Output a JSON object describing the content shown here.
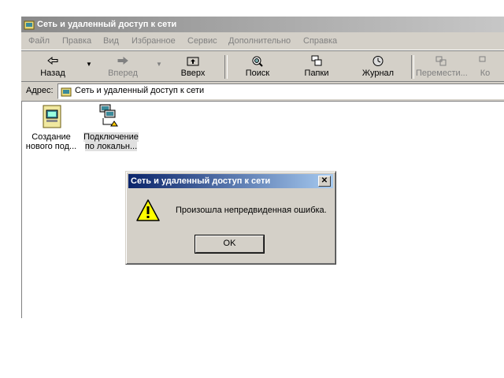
{
  "window": {
    "title": "Сеть и удаленный доступ к сети"
  },
  "menu": [
    "Файл",
    "Правка",
    "Вид",
    "Избранное",
    "Сервис",
    "Дополнительно",
    "Справка"
  ],
  "toolbar": {
    "back": "Назад",
    "forward": "Вперед",
    "up": "Вверх",
    "search": "Поиск",
    "folders": "Папки",
    "history": "Журнал",
    "move": "Перемести...",
    "copy": "Ко"
  },
  "address": {
    "label": "Адрес:",
    "value": "Сеть и удаленный доступ к сети"
  },
  "items": [
    {
      "label_line1": "Создание",
      "label_line2": "нового под..."
    },
    {
      "label_line1": "Подключение",
      "label_line2": "по локальн..."
    }
  ],
  "dialog": {
    "title": "Сеть и удаленный доступ к сети",
    "close": "✕",
    "message": "Произошла непредвиденная ошибка.",
    "ok": "OK"
  }
}
